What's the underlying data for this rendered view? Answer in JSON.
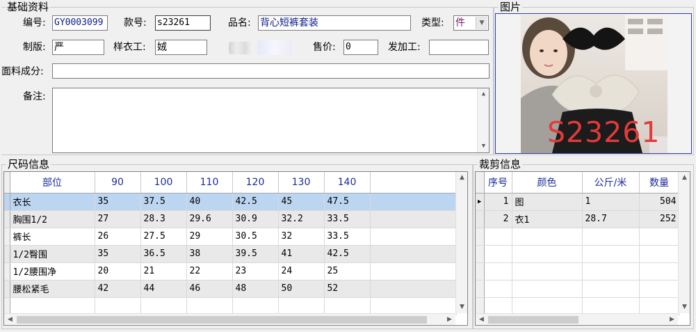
{
  "basic": {
    "title": "基础资料",
    "code_label": "编号:",
    "code_value": "GY0003099",
    "style_label": "款号:",
    "style_value": "s23261",
    "name_label": "品名:",
    "name_value": "背心短裤套装",
    "type_label": "类型:",
    "type_value": "件",
    "pattern_label": "制版:",
    "pattern_value": "严",
    "sample_label": "样衣工:",
    "sample_value": "娀",
    "price_label": "售价:",
    "price_value": "0",
    "process_label": "发加工:",
    "process_value": "",
    "fabric_label": "面料成分:",
    "fabric_value": "",
    "remark_label": "备注:",
    "remark_value": ""
  },
  "picture": {
    "title": "图片",
    "watermark": "S23261"
  },
  "size_info": {
    "title": "尺码信息",
    "columns": [
      "部位",
      "90",
      "100",
      "110",
      "120",
      "130",
      "140"
    ],
    "rows": [
      [
        "衣长",
        "35",
        "37.5",
        "40",
        "42.5",
        "45",
        "47.5"
      ],
      [
        "胸围1/2",
        "27",
        "28.3",
        "29.6",
        "30.9",
        "32.2",
        "33.5"
      ],
      [
        "裤长",
        "26",
        "27.5",
        "29",
        "30.5",
        "32",
        "33.5"
      ],
      [
        "1/2臀围",
        "35",
        "36.5",
        "38",
        "39.5",
        "41",
        "42.5"
      ],
      [
        "1/2腰围净",
        "20",
        "21",
        "22",
        "23",
        "24",
        "25"
      ],
      [
        "腰松紧毛",
        "42",
        "44",
        "46",
        "48",
        "50",
        "52"
      ]
    ]
  },
  "cut_info": {
    "title": "裁剪信息",
    "columns": [
      "序号",
      "颜色",
      "公斤/米",
      "数量"
    ],
    "rows": [
      [
        "1",
        "图",
        "1",
        "504"
      ],
      [
        "2",
        "衣1",
        "28.7",
        "252"
      ]
    ]
  },
  "colors": {
    "header_text": "#1a2a9c",
    "selected_row": "#bcd6f2",
    "watermark": "#e23a3a"
  }
}
